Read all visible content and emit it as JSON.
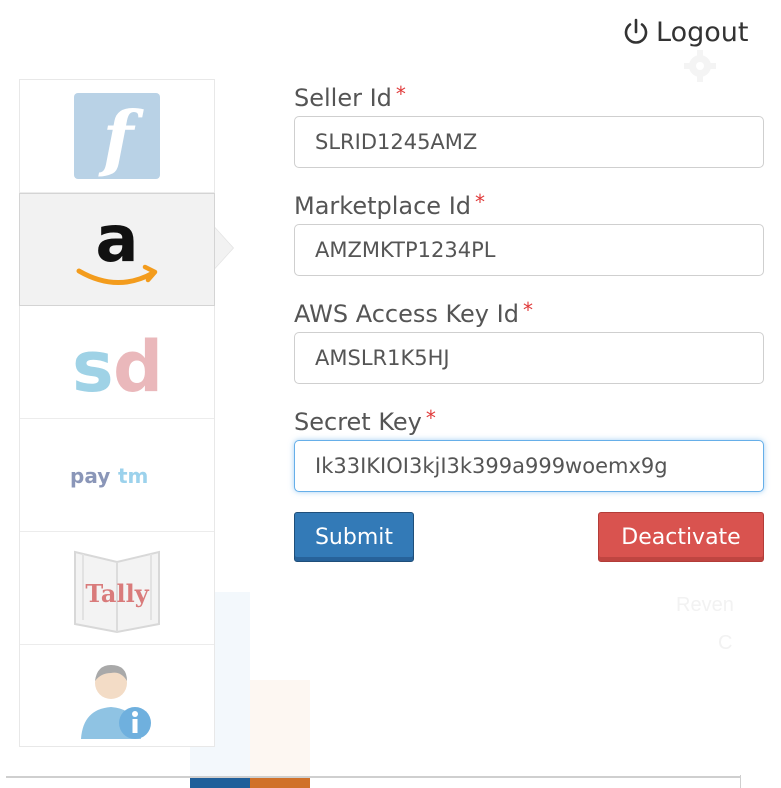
{
  "header": {
    "logout_label": "Logout",
    "logout_icon": "power-icon"
  },
  "channels": {
    "items": [
      {
        "name": "flipkart",
        "icon": "flipkart-logo",
        "glyph": "f",
        "color": "#8fb4d4",
        "active": false
      },
      {
        "name": "amazon",
        "icon": "amazon-logo",
        "glyph": "a",
        "color": "#111111",
        "accent": "#f39c1d",
        "active": true
      },
      {
        "name": "snapdeal",
        "icon": "snapdeal-logo",
        "glyph_s": "s",
        "glyph_d": "d",
        "color_s": "#9fd2e6",
        "color_d": "#eab8bb",
        "active": false
      },
      {
        "name": "paytm",
        "icon": "paytm-logo",
        "glyph_pay": "pay",
        "glyph_tm": "tm",
        "color_pay": "#8a96b8",
        "color_tm": "#9cd2ec",
        "active": false
      },
      {
        "name": "tally",
        "icon": "tally-logo",
        "glyph": "Tally",
        "color": "#d97b7b",
        "active": false
      },
      {
        "name": "user-info",
        "icon": "user-info-icon",
        "color": "#8fc3e3",
        "active": false
      }
    ]
  },
  "form": {
    "seller_id": {
      "label": "Seller Id",
      "value": "SLRID1245AMZ",
      "required_mark": "*"
    },
    "marketplace_id": {
      "label": "Marketplace Id",
      "value": "AMZMKTP1234PL",
      "required_mark": "*"
    },
    "aws_access_key_id": {
      "label": "AWS Access Key Id",
      "value": "AMSLR1K5HJ",
      "required_mark": "*"
    },
    "secret_key": {
      "label": "Secret Key",
      "value": "Ik33IKIOI3kjI3k399a999woemx9g",
      "required_mark": "*"
    }
  },
  "actions": {
    "submit_label": "Submit",
    "deactivate_label": "Deactivate"
  },
  "colors": {
    "primary": "#337ab7",
    "danger": "#d9534f",
    "required": "#e03a3a",
    "focus": "#66afe9"
  },
  "background": {
    "ghost_text_1": "Reven",
    "ghost_text_2": "C"
  }
}
